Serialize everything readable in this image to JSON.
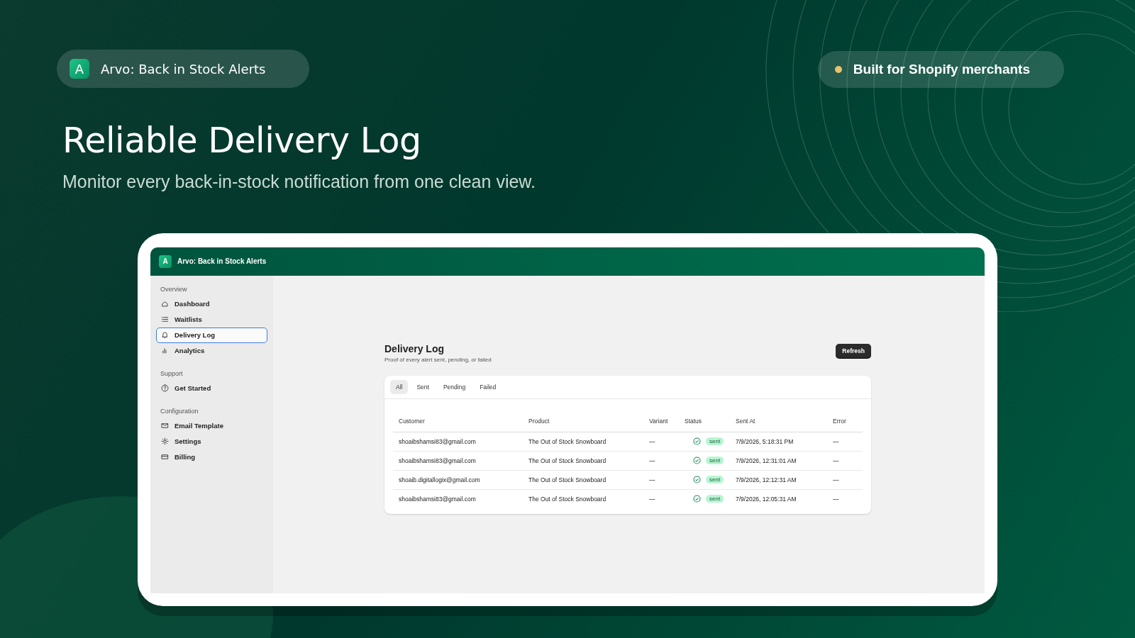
{
  "brand_badge": {
    "logo": "A",
    "name": "Arvo: Back in Stock Alerts"
  },
  "tagline_badge": {
    "text": "Built for Shopify merchants"
  },
  "headline": "Reliable Delivery Log",
  "subheadline": "Monitor every back-in-stock notification from one clean view.",
  "app": {
    "header": {
      "logo": "A",
      "title": "Arvo: Back in Stock Alerts"
    },
    "sidebar": {
      "groups": [
        {
          "label": "Overview",
          "items": [
            {
              "label": "Dashboard",
              "selected": false
            },
            {
              "label": "Waitlists",
              "selected": false
            },
            {
              "label": "Delivery Log",
              "selected": true
            },
            {
              "label": "Analytics",
              "selected": false
            }
          ]
        },
        {
          "label": "Support",
          "items": [
            {
              "label": "Get Started",
              "selected": false
            }
          ]
        },
        {
          "label": "Configuration",
          "items": [
            {
              "label": "Email Template",
              "selected": false
            },
            {
              "label": "Settings",
              "selected": false
            },
            {
              "label": "Billing",
              "selected": false
            }
          ]
        }
      ]
    },
    "page": {
      "title": "Delivery Log",
      "subtitle": "Proof of every alert sent, pending, or failed",
      "refresh_button": "Refresh",
      "tabs": [
        {
          "label": "All",
          "selected": true
        },
        {
          "label": "Sent",
          "selected": false
        },
        {
          "label": "Pending",
          "selected": false
        },
        {
          "label": "Failed",
          "selected": false
        }
      ],
      "table": {
        "columns": [
          "Customer",
          "Product",
          "Variant",
          "Status",
          "Sent At",
          "Error"
        ],
        "rows": [
          {
            "customer": "shoaibshamsi83@gmail.com",
            "product": "The Out of Stock Snowboard",
            "variant": "—",
            "status": "sent",
            "sent_at": "7/9/2026, 5:18:31 PM",
            "error": "—"
          },
          {
            "customer": "shoaibshamsi83@gmail.com",
            "product": "The Out of Stock Snowboard",
            "variant": "—",
            "status": "sent",
            "sent_at": "7/9/2026, 12:31:01 AM",
            "error": "—"
          },
          {
            "customer": "shoaib.digitallogix@gmail.com",
            "product": "The Out of Stock Snowboard",
            "variant": "—",
            "status": "sent",
            "sent_at": "7/9/2026, 12:12:31 AM",
            "error": "—"
          },
          {
            "customer": "shoaibshamsi83@gmail.com",
            "product": "The Out of Stock Snowboard",
            "variant": "—",
            "status": "sent",
            "sent_at": "7/9/2026, 12:05:31 AM",
            "error": "—"
          }
        ]
      }
    }
  }
}
